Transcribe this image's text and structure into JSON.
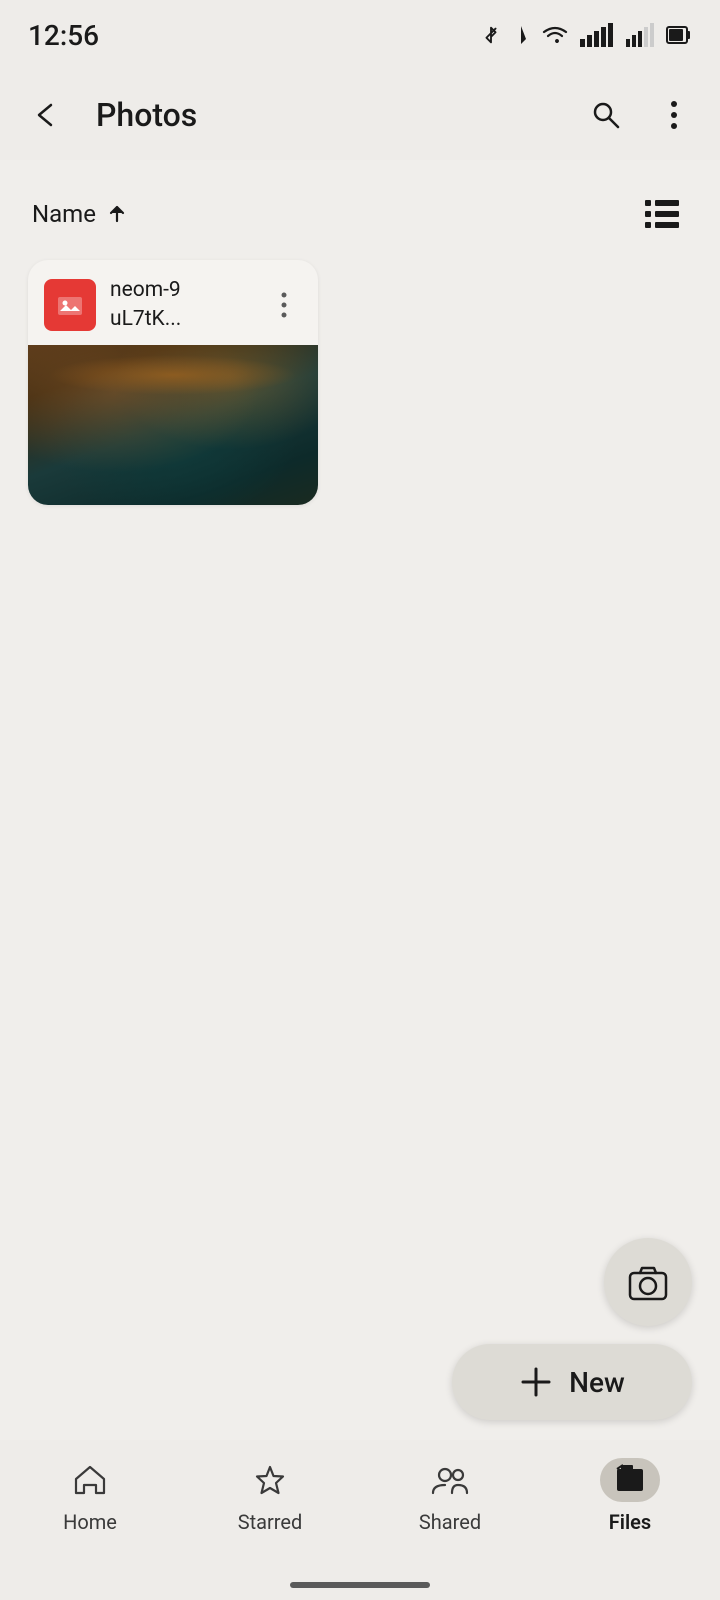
{
  "statusBar": {
    "time": "12:56"
  },
  "appBar": {
    "title": "Photos",
    "backLabel": "back",
    "searchLabel": "search",
    "moreLabel": "more options"
  },
  "sortBar": {
    "label": "Name",
    "direction": "ascending",
    "viewToggleLabel": "list view"
  },
  "files": [
    {
      "name": "neom-9\nuL7tK...",
      "shortName": "neom-9\nuL7tK..."
    }
  ],
  "fab": {
    "cameraLabel": "scan",
    "newLabel": "New",
    "newIcon": "+"
  },
  "bottomNav": {
    "items": [
      {
        "id": "home",
        "label": "Home",
        "active": false
      },
      {
        "id": "starred",
        "label": "Starred",
        "active": false
      },
      {
        "id": "shared",
        "label": "Shared",
        "active": false
      },
      {
        "id": "files",
        "label": "Files",
        "active": true
      }
    ]
  }
}
